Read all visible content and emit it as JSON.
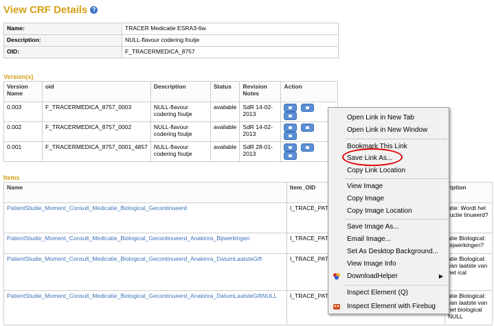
{
  "page": {
    "title": "View CRF Details"
  },
  "info": {
    "rows": [
      {
        "label": "Name:",
        "value": "TRACER Medicatie ESRA3-6w"
      },
      {
        "label": "Description:",
        "value": "NULL-flavour codering foutje"
      },
      {
        "label": "OID:",
        "value": "F_TRACERMEDICA_8757"
      }
    ]
  },
  "versions": {
    "section_label": "Version(s)",
    "headers": {
      "version_name": "Version Name",
      "oid": "oid",
      "description": "Description",
      "status": "Status",
      "revision_notes": "Revision Notes",
      "action": "Action"
    },
    "rows": [
      {
        "version": "0.003",
        "oid": "F_TRACERMEDICA_8757_0003",
        "description": "NULL-flavour codering foutje",
        "status": "available",
        "notes": "SdR 14-02-2013"
      },
      {
        "version": "0.002",
        "oid": "F_TRACERMEDICA_8757_0002",
        "description": "NULL-flavour codering foutje",
        "status": "available",
        "notes": "SdR 14-02-2013"
      },
      {
        "version": "0.001",
        "oid": "F_TRACERMEDICA_8757_0001_4857",
        "description": "NULL-flavour codering foutje",
        "status": "available",
        "notes": "SdR 28-01-2013"
      }
    ]
  },
  "items": {
    "section_label": "Items",
    "headers": {
      "name": "Name",
      "item_oid": "Item_OID",
      "description": "ription"
    },
    "rows": [
      {
        "name": "PatientStudie_Moment_Consult_Medicatie_Biological_Gecontinueerd",
        "oid": "I_TRACE_PAT",
        "desc": "atie: Wordt het ructie tinueerd?"
      },
      {
        "name": "PatientStudie_Moment_Consult_Medicatie_Biological_Gecontinueerd_Anakinra_Bijwerkingen",
        "oid": "I_TRACE_PAT",
        "desc": "atie Biological: bijwerkingen?"
      },
      {
        "name": "PatientStudie_Moment_Consult_Medicatie_Biological_Gecontinueerd_Anakinra_DatumLaatsteGift",
        "oid": "I_TRACE_PAT",
        "desc": "atie Biological: van laatste van het ical"
      },
      {
        "name": "PatientStudie_Moment_Consult_Medicatie_Biological_Gecontinueerd_Anakinra_DatumLaatsteGiftNULL",
        "oid": "I_TRACE_PAT",
        "desc": "atie Biological: van laatste van het biological NULL"
      }
    ]
  },
  "context_menu": {
    "items": [
      "Open Link in New Tab",
      "Open Link in New Window",
      "Bookmark This Link",
      "Save Link As...",
      "Copy Link Location",
      "View Image",
      "Copy Image",
      "Copy Image Location",
      "Save Image As...",
      "Email Image...",
      "Set As Desktop Background...",
      "View Image Info",
      "DownloadHelper",
      "Inspect Element (Q)",
      "Inspect Element with Firebug"
    ]
  }
}
